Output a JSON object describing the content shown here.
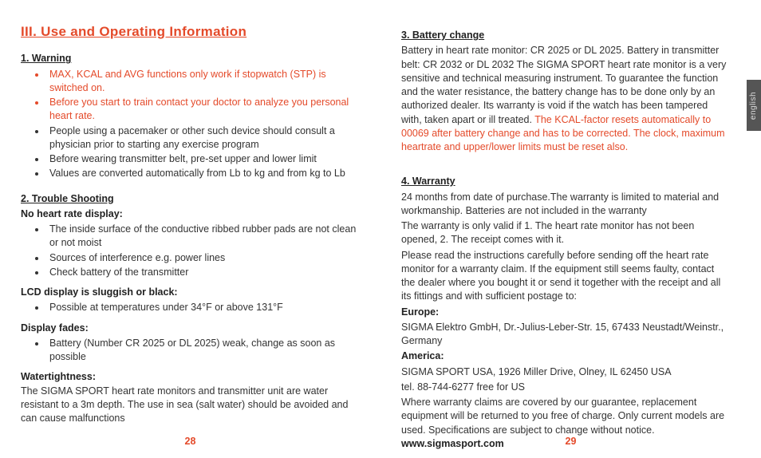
{
  "tab": "english",
  "left": {
    "title": "III. Use and Operating Information",
    "s1_head": "1. Warning",
    "s1_bullets_red": [
      "MAX, KCAL and AVG functions only work if stopwatch (STP) is switched on.",
      "Before you start to train contact your doctor to analyze you personal heart rate."
    ],
    "s1_bullets": [
      "People using a pacemaker or other such device should consult a physician prior to starting any exercise program",
      "Before wearing transmitter belt, pre-set upper and lower limit",
      "Values are converted automatically from Lb to kg and from kg to Lb"
    ],
    "s2_head": "2. Trouble Shooting",
    "s2_a_label": "No heart rate display:",
    "s2_a_bullets": [
      "The inside surface of the conductive ribbed rubber pads are not clean or not moist",
      "Sources of interference e.g. power lines",
      "Check battery of the transmitter"
    ],
    "s2_b_label": "LCD display is sluggish or black:",
    "s2_b_bullets": [
      "Possible at temperatures under 34°F or above 131°F"
    ],
    "s2_c_label": "Display fades:",
    "s2_c_bullets": [
      "Battery (Number CR 2025 or DL 2025) weak, change as soon as possible"
    ],
    "s2_d_label": "Watertightness:",
    "s2_d_text": "The SIGMA SPORT heart rate monitors  and transmitter unit are water resistant to a 3m depth. The use in sea (salt water) should be avoided and can cause malfunctions",
    "page_num": "28"
  },
  "right": {
    "s3_head": "3. Battery change",
    "s3_body": "Battery in heart rate monitor: CR 2025 or DL 2025. Battery in transmitter belt: CR 2032 or DL 2032 The SIGMA SPORT heart rate monitor is a very sensitive and technical measuring instrument. To guarantee the function and the water resistance, the battery change has to be done only by an authorized dealer. Its warranty is void if the watch has been tampered with, taken apart or ill treated. ",
    "s3_red": "The KCAL-factor resets automatically to 00069 after battery change and has to be corrected. The clock, maximum heartrate and upper/lower limits must be reset also.",
    "s4_head": "4. Warranty",
    "s4_p1": "24 months from date of purchase.The warranty is limited to material and workmanship. Batteries are not included in the warranty",
    "s4_p2": "The warranty is only valid if 1. The heart rate monitor has not been opened, 2. The receipt comes with it.",
    "s4_p3": "Please read the instructions carefully before sending off the heart rate monitor for a warranty claim. If the equipment still seems faulty, contact the dealer where you bought it or send it together with the receipt and all its fittings and with sufficient postage to:",
    "eu_label": "Europe:",
    "eu_addr": "SIGMA Elektro GmbH, Dr.-Julius-Leber-Str. 15, 67433 Neustadt/Weinstr., Germany",
    "us_label": "America:",
    "us_addr1": "SIGMA SPORT USA, 1926 Miller Drive, Olney, IL 62450 USA",
    "us_addr2": "tel. 88-744-6277 free for US",
    "s4_p4": "Where warranty claims are covered by our guarantee, replacement equipment will be returned to you free of charge. Only current models are used. Specifications are subject to change without notice. ",
    "site": "www.sigmasport.com",
    "page_num": "29"
  }
}
